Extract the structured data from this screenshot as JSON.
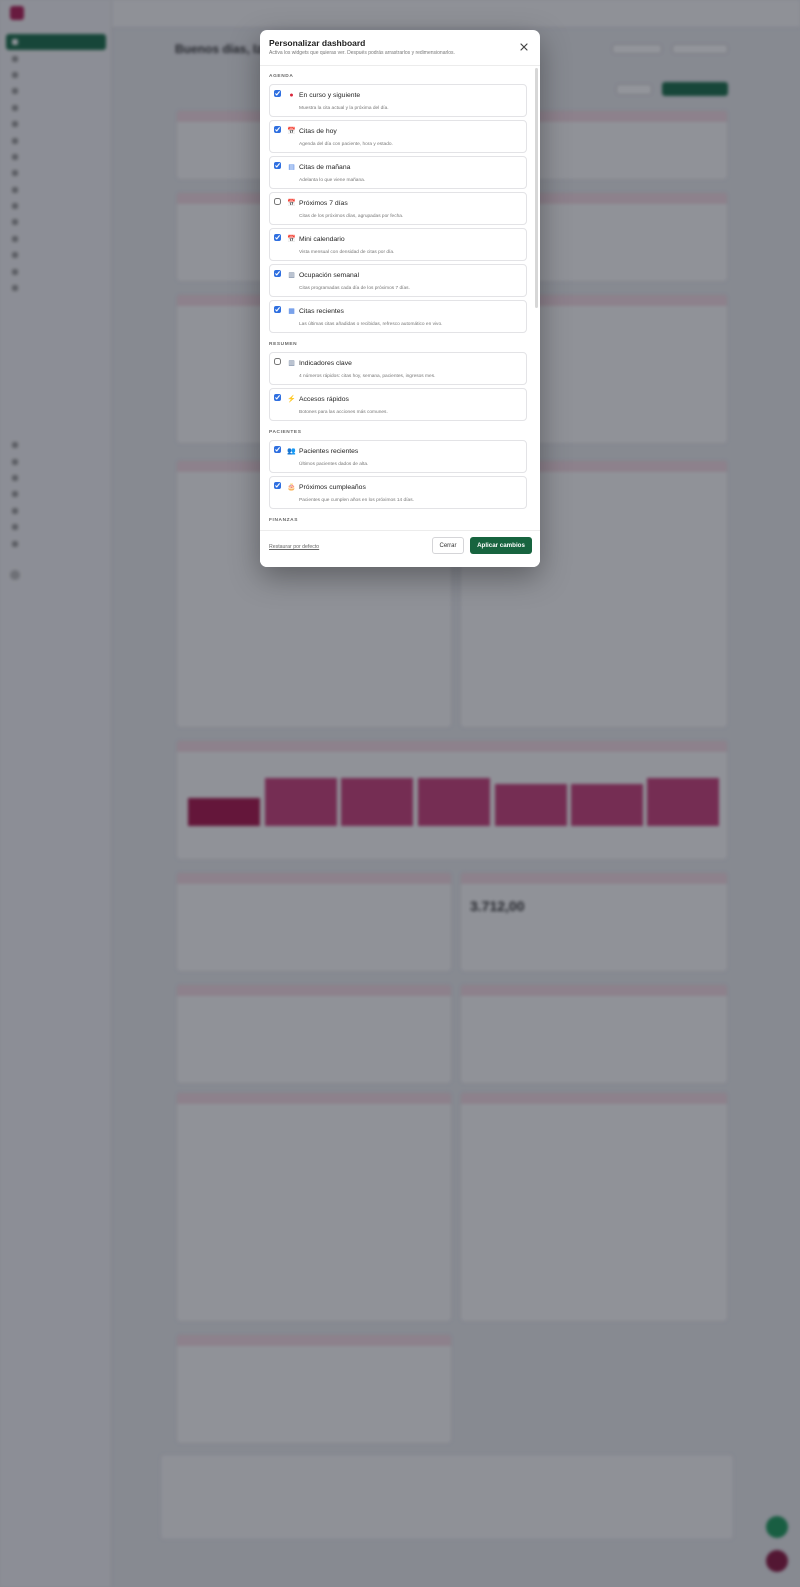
{
  "modal": {
    "title": "Personalizar dashboard",
    "subtitle": "Activa los widgets que quieras ver. Después podrás arrastrarlos y redimensionarlos.",
    "sections": [
      {
        "label": "AGENDA",
        "items": [
          {
            "icon": "red-circle-icon",
            "glyph": "●",
            "color": "#d9263b",
            "title": "En curso y siguiente",
            "description": "Muestra la cita actual y la próxima del día.",
            "checked": true
          },
          {
            "icon": "calendar-icon",
            "glyph": "📅",
            "color": "#c0392b",
            "title": "Citas de hoy",
            "description": "Agenda del día con paciente, hora y estado.",
            "checked": true
          },
          {
            "icon": "tomorrow-icon",
            "glyph": "▤",
            "color": "#2f6fe0",
            "title": "Citas de mañana",
            "description": "Adelanta lo que viene mañana.",
            "checked": true
          },
          {
            "icon": "calendar-icon",
            "glyph": "📅",
            "color": "#c0392b",
            "title": "Próximos 7 días",
            "description": "Citas de los próximos días, agrupadas por fecha.",
            "checked": false
          },
          {
            "icon": "mini-calendar-icon",
            "glyph": "📅",
            "color": "#c0392b",
            "title": "Mini calendario",
            "description": "Vista mensual con densidad de citas por día.",
            "checked": true
          },
          {
            "icon": "bar-chart-icon",
            "glyph": "▥",
            "color": "#5a6f8f",
            "title": "Ocupación semanal",
            "description": "Citas programadas cada día de los próximos 7 días.",
            "checked": true
          },
          {
            "icon": "new-icon",
            "glyph": "▦",
            "color": "#2f6fe0",
            "title": "Citas recientes",
            "description": "Las últimas citas añadidas o recibidas, refresco automático en vivo.",
            "checked": true
          }
        ]
      },
      {
        "label": "RESUMEN",
        "items": [
          {
            "icon": "chart-icon",
            "glyph": "▥",
            "color": "#5a6f8f",
            "title": "Indicadores clave",
            "description": "4 números rápidos: citas hoy, semana, pacientes, ingresos mes.",
            "checked": false
          },
          {
            "icon": "lightning-icon",
            "glyph": "⚡",
            "color": "#e8a317",
            "title": "Accesos rápidos",
            "description": "Botones para las acciones más comunes.",
            "checked": true
          }
        ]
      },
      {
        "label": "PACIENTES",
        "items": [
          {
            "icon": "people-icon",
            "glyph": "👥",
            "color": "#3a5fa0",
            "title": "Pacientes recientes",
            "description": "Últimos pacientes dados de alta.",
            "checked": true
          },
          {
            "icon": "birthday-cake-icon",
            "glyph": "🎂",
            "color": "#d9468a",
            "title": "Próximos cumpleaños",
            "description": "Pacientes que cumplen años en los próximos 14 días.",
            "checked": true
          }
        ]
      },
      {
        "label": "FINANZAS",
        "items": []
      }
    ],
    "footer": {
      "restore_label": "Restaurar por defecto",
      "close_label": "Cerrar",
      "apply_label": "Aplicar cambios"
    }
  },
  "background": {
    "greeting": "Buenos días, Izan",
    "kpi_value": "3.712,00",
    "accent_color": "#b01e55",
    "primary_color": "#17643f"
  }
}
